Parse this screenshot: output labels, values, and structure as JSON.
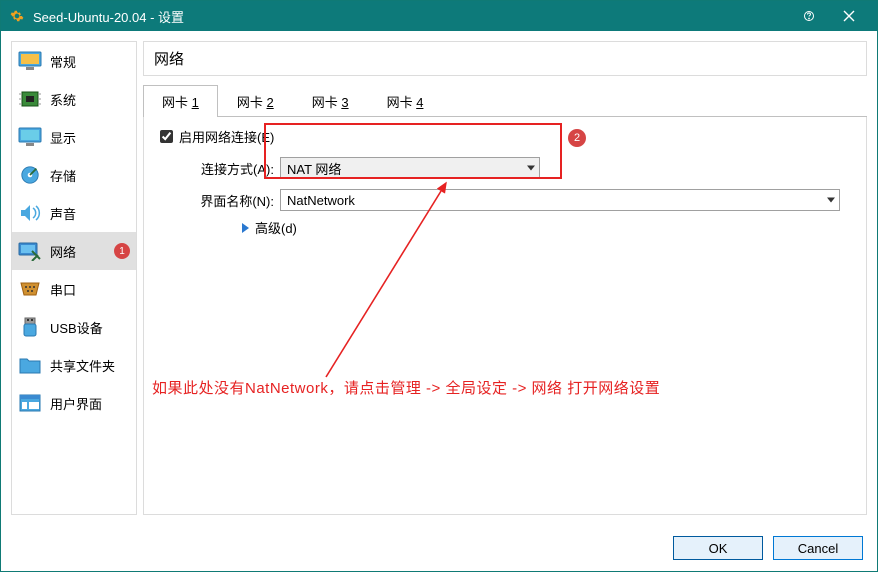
{
  "window_title": "Seed-Ubuntu-20.04 - 设置",
  "sidebar": {
    "items": [
      {
        "label": "常规"
      },
      {
        "label": "系统"
      },
      {
        "label": "显示"
      },
      {
        "label": "存储"
      },
      {
        "label": "声音"
      },
      {
        "label": "网络"
      },
      {
        "label": "串口"
      },
      {
        "label": "USB设备"
      },
      {
        "label": "共享文件夹"
      },
      {
        "label": "用户界面"
      }
    ],
    "selected_index": 5,
    "badge_on_selected": "1"
  },
  "content": {
    "section_title": "网络",
    "tabs": [
      "网卡 1",
      "网卡 2",
      "网卡 3",
      "网卡 4"
    ],
    "active_tab": 0,
    "enable_checkbox_label": "启用网络连接(E)",
    "enable_checkbox_checked": true,
    "conn_label": "连接方式(A):",
    "conn_value": "NAT 网络",
    "iface_label": "界面名称(N):",
    "iface_value": "NatNetwork",
    "advanced_label": "高级(d)"
  },
  "annotation": {
    "badge2": "2",
    "note": "如果此处没有NatNetwork，请点击管理 -> 全局设定 -> 网络 打开网络设置"
  },
  "footer": {
    "ok": "OK",
    "cancel": "Cancel"
  }
}
